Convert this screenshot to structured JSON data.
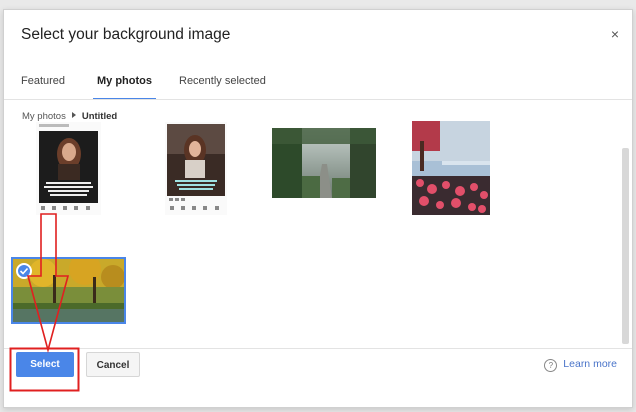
{
  "dialog": {
    "title": "Select your background image",
    "close_icon": "×"
  },
  "tabs": [
    {
      "label": "Featured"
    },
    {
      "label": "My photos"
    },
    {
      "label": "Recently selected"
    }
  ],
  "breadcrumb": {
    "root": "My photos",
    "current": "Untitled"
  },
  "footer": {
    "select_label": "Select",
    "cancel_label": "Cancel",
    "help_glyph": "?",
    "learn_more_label": "Learn more"
  },
  "colors": {
    "accent": "#4a86e8",
    "annotation": "#e02020"
  },
  "icons": [
    "close-icon",
    "chevron-right-icon",
    "check-icon",
    "help-icon"
  ]
}
